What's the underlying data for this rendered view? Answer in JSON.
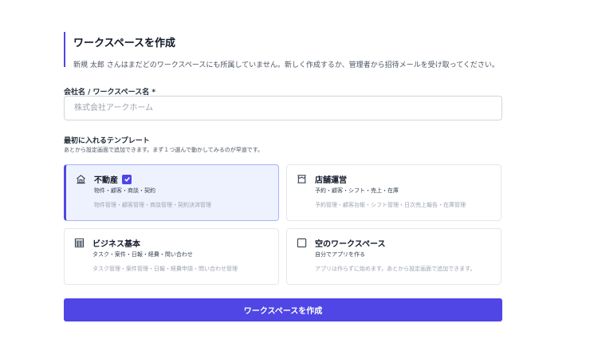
{
  "header": {
    "title": "ワークスペースを作成",
    "subtitle": "新規 太郎 さんはまだどのワークスペースにも所属していません。新しく作成するか、管理者から招待メールを受け取ってください。"
  },
  "company_field": {
    "label": "会社名 / ワークスペース名 *",
    "value": "",
    "placeholder": "株式会社アークホーム"
  },
  "templates": {
    "label": "最初に入れるテンプレート",
    "help": "あとから設定画面で追加できます。まず１つ選んで動かしてみるのが早道です。",
    "items": [
      {
        "icon": "house-icon",
        "name": "不動産",
        "selected": true,
        "sub": "物件・顧客・商談・契約",
        "detail": "物件管理・顧客管理・商談管理・契約決済管理"
      },
      {
        "icon": "storefront-icon",
        "name": "店舗運営",
        "selected": false,
        "sub": "予約・顧客・シフト・売上・在庫",
        "detail": "予約管理・顧客台帳・シフト管理・日次売上報告・在庫管理"
      },
      {
        "icon": "spreadsheet-icon",
        "name": "ビジネス基本",
        "selected": false,
        "sub": "タスク・案件・日報・経費・問い合わせ",
        "detail": "タスク管理・案件管理・日報・経費申請・問い合わせ管理"
      },
      {
        "icon": "empty-square-icon",
        "name": "空のワークスペース",
        "selected": false,
        "sub": "自分でアプリを作る",
        "detail": "アプリは作らずに始めます。あとから設定画面で追加できます。"
      }
    ]
  },
  "submit": {
    "label": "ワークスペースを作成"
  },
  "colors": {
    "accent": "#4f46e5",
    "selected_bg": "#eef2ff",
    "border": "#e5e7eb"
  }
}
